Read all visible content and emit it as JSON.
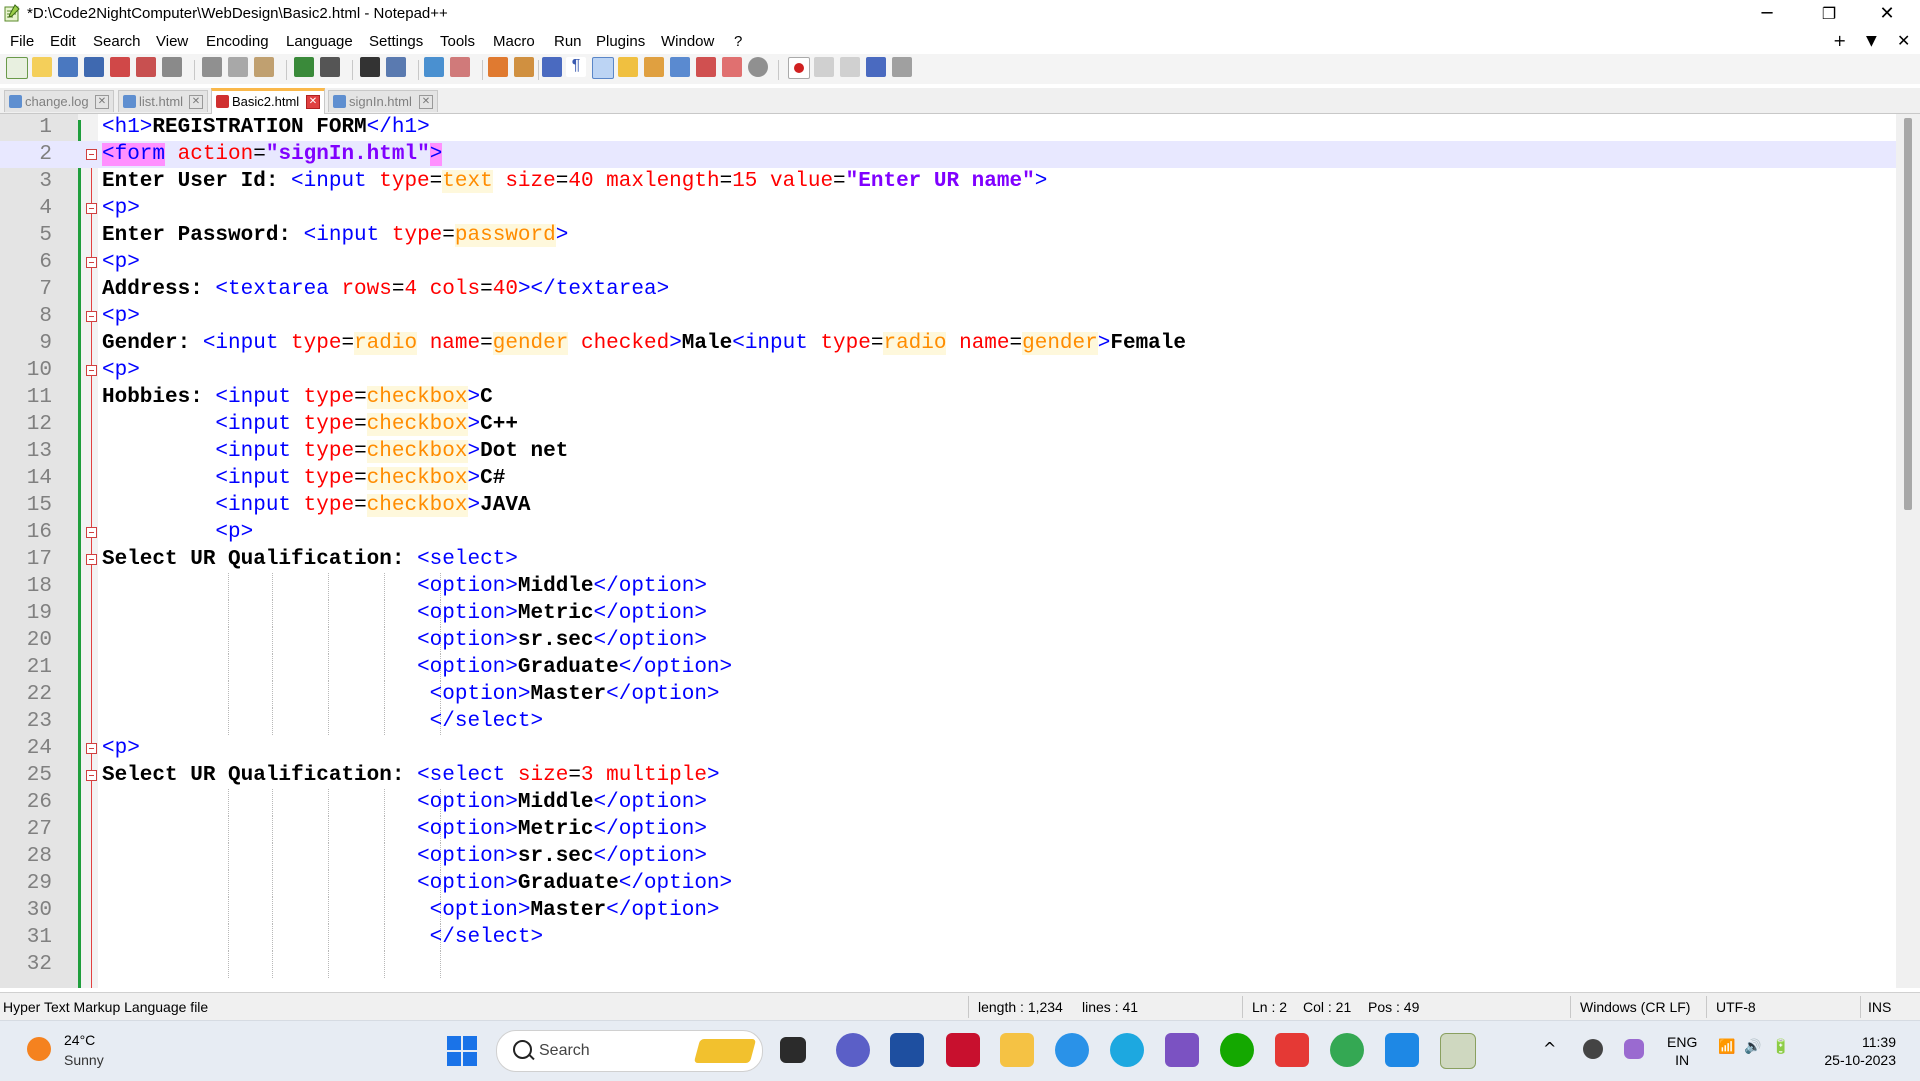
{
  "window": {
    "title": "*D:\\Code2NightComputer\\WebDesign\\Basic2.html - Notepad++",
    "minimize": "─",
    "restore": "❐",
    "close": "✕"
  },
  "menu": {
    "items": [
      "File",
      "Edit",
      "Search",
      "View",
      "Encoding",
      "Language",
      "Settings",
      "Tools",
      "Macro",
      "Run",
      "Plugins",
      "Window",
      "?"
    ],
    "right_plus": "+",
    "right_down": "▼",
    "right_close": "✕"
  },
  "tabs": [
    {
      "label": "change.log",
      "active": false
    },
    {
      "label": "list.html",
      "active": false
    },
    {
      "label": "Basic2.html",
      "active": true
    },
    {
      "label": "signIn.html",
      "active": false
    }
  ],
  "editor": {
    "current_line": 2,
    "lines": [
      {
        "n": "1",
        "fold": false,
        "segs": [
          [
            "t",
            "<h1>"
          ],
          [
            "x",
            "REGISTRATION FORM"
          ],
          [
            "t",
            "</h1>"
          ]
        ]
      },
      {
        "n": "2",
        "fold": true,
        "segs": [
          [
            "m",
            "<form"
          ],
          [
            "p",
            " "
          ],
          [
            "a",
            "action"
          ],
          [
            "p",
            "="
          ],
          [
            "v",
            "\"signIn.html\""
          ],
          [
            "m",
            ">"
          ]
        ]
      },
      {
        "n": "3",
        "fold": false,
        "segs": [
          [
            "x",
            "Enter User Id: "
          ],
          [
            "t",
            "<input "
          ],
          [
            "a",
            "type"
          ],
          [
            "p",
            "="
          ],
          [
            "s",
            "text"
          ],
          [
            "p",
            " "
          ],
          [
            "a",
            "size"
          ],
          [
            "p",
            "="
          ],
          [
            "a",
            "40"
          ],
          [
            "p",
            " "
          ],
          [
            "a",
            "maxlength"
          ],
          [
            "p",
            "="
          ],
          [
            "a",
            "15"
          ],
          [
            "p",
            " "
          ],
          [
            "a",
            "value"
          ],
          [
            "p",
            "="
          ],
          [
            "v",
            "\"Enter UR name\""
          ],
          [
            "t",
            ">"
          ]
        ]
      },
      {
        "n": "4",
        "fold": true,
        "segs": [
          [
            "t",
            "<p>"
          ]
        ]
      },
      {
        "n": "5",
        "fold": false,
        "segs": [
          [
            "x",
            "Enter Password: "
          ],
          [
            "t",
            "<input "
          ],
          [
            "a",
            "type"
          ],
          [
            "p",
            "="
          ],
          [
            "s",
            "password"
          ],
          [
            "t",
            ">"
          ]
        ]
      },
      {
        "n": "6",
        "fold": true,
        "segs": [
          [
            "t",
            "<p>"
          ]
        ]
      },
      {
        "n": "7",
        "fold": false,
        "segs": [
          [
            "x",
            "Address: "
          ],
          [
            "t",
            "<textarea "
          ],
          [
            "a",
            "rows"
          ],
          [
            "p",
            "="
          ],
          [
            "a",
            "4"
          ],
          [
            "p",
            " "
          ],
          [
            "a",
            "cols"
          ],
          [
            "p",
            "="
          ],
          [
            "a",
            "40"
          ],
          [
            "t",
            "></textarea>"
          ]
        ]
      },
      {
        "n": "8",
        "fold": true,
        "segs": [
          [
            "t",
            "<p>"
          ]
        ]
      },
      {
        "n": "9",
        "fold": false,
        "segs": [
          [
            "x",
            "Gender: "
          ],
          [
            "t",
            "<input "
          ],
          [
            "a",
            "type"
          ],
          [
            "p",
            "="
          ],
          [
            "s",
            "radio"
          ],
          [
            "p",
            " "
          ],
          [
            "a",
            "name"
          ],
          [
            "p",
            "="
          ],
          [
            "s",
            "gender"
          ],
          [
            "p",
            " "
          ],
          [
            "a",
            "checked"
          ],
          [
            "t",
            ">"
          ],
          [
            "x",
            "Male"
          ],
          [
            "t",
            "<input "
          ],
          [
            "a",
            "type"
          ],
          [
            "p",
            "="
          ],
          [
            "s",
            "radio"
          ],
          [
            "p",
            " "
          ],
          [
            "a",
            "name"
          ],
          [
            "p",
            "="
          ],
          [
            "s",
            "gender"
          ],
          [
            "t",
            ">"
          ],
          [
            "x",
            "Female"
          ]
        ]
      },
      {
        "n": "10",
        "fold": true,
        "segs": [
          [
            "t",
            "<p>"
          ]
        ]
      },
      {
        "n": "11",
        "fold": false,
        "segs": [
          [
            "x",
            "Hobbies: "
          ],
          [
            "t",
            "<input "
          ],
          [
            "a",
            "type"
          ],
          [
            "p",
            "="
          ],
          [
            "s",
            "checkbox"
          ],
          [
            "t",
            ">"
          ],
          [
            "x",
            "C"
          ]
        ]
      },
      {
        "n": "12",
        "fold": false,
        "segs": [
          [
            "p",
            "         "
          ],
          [
            "t",
            "<input "
          ],
          [
            "a",
            "type"
          ],
          [
            "p",
            "="
          ],
          [
            "s",
            "checkbox"
          ],
          [
            "t",
            ">"
          ],
          [
            "x",
            "C++"
          ]
        ]
      },
      {
        "n": "13",
        "fold": false,
        "segs": [
          [
            "p",
            "         "
          ],
          [
            "t",
            "<input "
          ],
          [
            "a",
            "type"
          ],
          [
            "p",
            "="
          ],
          [
            "s",
            "checkbox"
          ],
          [
            "t",
            ">"
          ],
          [
            "x",
            "Dot net"
          ]
        ]
      },
      {
        "n": "14",
        "fold": false,
        "segs": [
          [
            "p",
            "         "
          ],
          [
            "t",
            "<input "
          ],
          [
            "a",
            "type"
          ],
          [
            "p",
            "="
          ],
          [
            "s",
            "checkbox"
          ],
          [
            "t",
            ">"
          ],
          [
            "x",
            "C#"
          ]
        ]
      },
      {
        "n": "15",
        "fold": false,
        "segs": [
          [
            "p",
            "         "
          ],
          [
            "t",
            "<input "
          ],
          [
            "a",
            "type"
          ],
          [
            "p",
            "="
          ],
          [
            "s",
            "checkbox"
          ],
          [
            "t",
            ">"
          ],
          [
            "x",
            "JAVA"
          ]
        ]
      },
      {
        "n": "16",
        "fold": true,
        "segs": [
          [
            "p",
            "         "
          ],
          [
            "t",
            "<p>"
          ]
        ]
      },
      {
        "n": "17",
        "fold": true,
        "segs": [
          [
            "x",
            "Select UR Qualification: "
          ],
          [
            "t",
            "<select>"
          ]
        ]
      },
      {
        "n": "18",
        "fold": false,
        "segs": [
          [
            "p",
            "                         "
          ],
          [
            "t",
            "<option>"
          ],
          [
            "x",
            "Middle"
          ],
          [
            "t",
            "</option>"
          ]
        ]
      },
      {
        "n": "19",
        "fold": false,
        "segs": [
          [
            "p",
            "                         "
          ],
          [
            "t",
            "<option>"
          ],
          [
            "x",
            "Metric"
          ],
          [
            "t",
            "</option>"
          ]
        ]
      },
      {
        "n": "20",
        "fold": false,
        "segs": [
          [
            "p",
            "                         "
          ],
          [
            "t",
            "<option>"
          ],
          [
            "x",
            "sr.sec"
          ],
          [
            "t",
            "</option>"
          ]
        ]
      },
      {
        "n": "21",
        "fold": false,
        "segs": [
          [
            "p",
            "                         "
          ],
          [
            "t",
            "<option>"
          ],
          [
            "x",
            "Graduate"
          ],
          [
            "t",
            "</option>"
          ]
        ]
      },
      {
        "n": "22",
        "fold": false,
        "segs": [
          [
            "p",
            "                          "
          ],
          [
            "t",
            "<option>"
          ],
          [
            "x",
            "Master"
          ],
          [
            "t",
            "</option>"
          ]
        ]
      },
      {
        "n": "23",
        "fold": false,
        "segs": [
          [
            "p",
            "                          "
          ],
          [
            "t",
            "</select>"
          ]
        ]
      },
      {
        "n": "24",
        "fold": true,
        "segs": [
          [
            "t",
            "<p>"
          ]
        ]
      },
      {
        "n": "25",
        "fold": true,
        "segs": [
          [
            "x",
            "Select UR Qualification: "
          ],
          [
            "t",
            "<select "
          ],
          [
            "a",
            "size"
          ],
          [
            "p",
            "="
          ],
          [
            "a",
            "3"
          ],
          [
            "p",
            " "
          ],
          [
            "a",
            "multiple"
          ],
          [
            "t",
            ">"
          ]
        ]
      },
      {
        "n": "26",
        "fold": false,
        "segs": [
          [
            "p",
            "                         "
          ],
          [
            "t",
            "<option>"
          ],
          [
            "x",
            "Middle"
          ],
          [
            "t",
            "</option>"
          ]
        ]
      },
      {
        "n": "27",
        "fold": false,
        "segs": [
          [
            "p",
            "                         "
          ],
          [
            "t",
            "<option>"
          ],
          [
            "x",
            "Metric"
          ],
          [
            "t",
            "</option>"
          ]
        ]
      },
      {
        "n": "28",
        "fold": false,
        "segs": [
          [
            "p",
            "                         "
          ],
          [
            "t",
            "<option>"
          ],
          [
            "x",
            "sr.sec"
          ],
          [
            "t",
            "</option>"
          ]
        ]
      },
      {
        "n": "29",
        "fold": false,
        "segs": [
          [
            "p",
            "                         "
          ],
          [
            "t",
            "<option>"
          ],
          [
            "x",
            "Graduate"
          ],
          [
            "t",
            "</option>"
          ]
        ]
      },
      {
        "n": "30",
        "fold": false,
        "segs": [
          [
            "p",
            "                          "
          ],
          [
            "t",
            "<option>"
          ],
          [
            "x",
            "Master"
          ],
          [
            "t",
            "</option>"
          ]
        ]
      },
      {
        "n": "31",
        "fold": false,
        "segs": [
          [
            "p",
            "                          "
          ],
          [
            "t",
            "</select>"
          ]
        ]
      },
      {
        "n": "32",
        "fold": false,
        "segs": []
      }
    ]
  },
  "status": {
    "filetype": "Hyper Text Markup Language file",
    "length": "length : 1,234",
    "lines": "lines : 41",
    "ln": "Ln : 2",
    "col": "Col : 21",
    "pos": "Pos : 49",
    "eol": "Windows (CR LF)",
    "encoding": "UTF-8",
    "mode": "INS"
  },
  "taskbar": {
    "weather_temp": "24°C",
    "weather_condition": "Sunny",
    "search_label": "Search",
    "language_top": "ENG",
    "language_bottom": "IN",
    "time": "11:39",
    "date": "25-10-2023",
    "tray_chevron": "^",
    "wifi": "📶",
    "volume": "🔊",
    "battery": "🔋"
  },
  "colors": {
    "tag": "#0000ff",
    "attribute": "#ff0000",
    "string": "#8000ff",
    "unquoted_value": "#ff8c00",
    "tag_match": "#ff90ff",
    "current_line": "#e8e8ff",
    "change_bar": "#1f9e3c"
  }
}
